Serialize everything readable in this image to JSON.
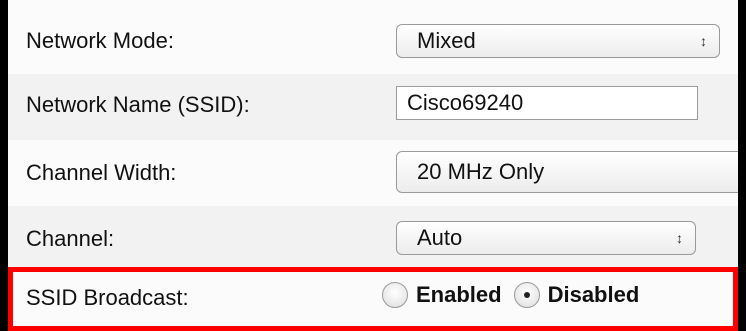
{
  "form": {
    "network_mode": {
      "label": "Network Mode:",
      "value": "Mixed",
      "arrows": "↕"
    },
    "network_name": {
      "label": "Network Name (SSID):",
      "value": "Cisco69240"
    },
    "channel_width": {
      "label": "Channel Width:",
      "value": "20 MHz Only"
    },
    "channel": {
      "label": "Channel:",
      "value": "Auto",
      "arrows": "↕"
    },
    "ssid_broadcast": {
      "label": "SSID Broadcast:",
      "options": [
        {
          "label": "Enabled",
          "selected": false
        },
        {
          "label": "Disabled",
          "selected": true
        }
      ]
    }
  },
  "colors": {
    "highlight_border": "#ff0000",
    "frame": "#000000"
  }
}
